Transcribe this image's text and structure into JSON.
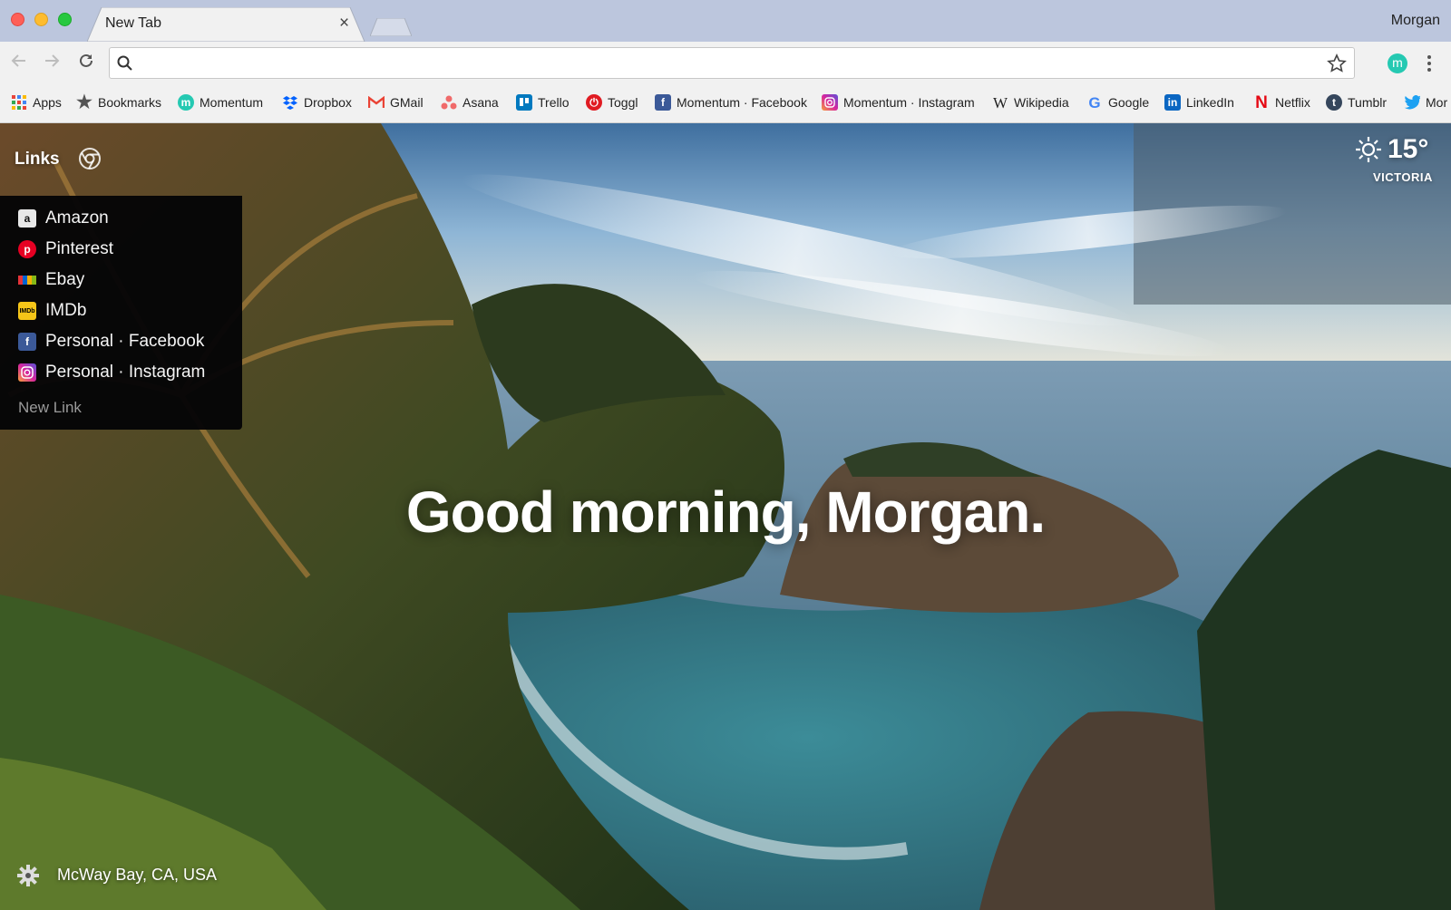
{
  "browser": {
    "tab_title": "New Tab",
    "tab_close": "×",
    "profile_name": "Morgan",
    "omnibox": {
      "value": "",
      "placeholder": ""
    },
    "extension_letter": "m",
    "bookmarks": [
      {
        "label": "Apps",
        "icon": "apps-grid-icon"
      },
      {
        "label": "Bookmarks",
        "icon": "star-icon"
      },
      {
        "label": "Momentum",
        "icon": "momentum-icon"
      },
      {
        "label": "Dropbox",
        "icon": "dropbox-icon"
      },
      {
        "label": "GMail",
        "icon": "gmail-icon"
      },
      {
        "label": "Asana",
        "icon": "asana-icon"
      },
      {
        "label": "Trello",
        "icon": "trello-icon"
      },
      {
        "label": "Toggl",
        "icon": "toggl-icon"
      },
      {
        "label": "Momentum · Facebook",
        "icon": "facebook-icon"
      },
      {
        "label": "Momentum · Instagram",
        "icon": "instagram-icon"
      },
      {
        "label": "Wikipedia",
        "icon": "wikipedia-icon"
      },
      {
        "label": "Google",
        "icon": "google-icon"
      },
      {
        "label": "LinkedIn",
        "icon": "linkedin-icon"
      },
      {
        "label": "Netflix",
        "icon": "netflix-icon"
      },
      {
        "label": "Tumblr",
        "icon": "tumblr-icon"
      },
      {
        "label": "Mor",
        "icon": "twitter-icon"
      }
    ]
  },
  "momentum": {
    "links_label": "Links",
    "links": [
      {
        "label": "Amazon",
        "icon": "amazon-icon"
      },
      {
        "label": "Pinterest",
        "icon": "pinterest-icon"
      },
      {
        "label": "Ebay",
        "icon": "ebay-icon"
      },
      {
        "label": "IMDb",
        "icon": "imdb-icon"
      },
      {
        "label": "Personal · Facebook",
        "icon": "facebook-icon"
      },
      {
        "label": "Personal · Instagram",
        "icon": "instagram-icon"
      }
    ],
    "new_link": "New Link",
    "weather": {
      "temp": "15°",
      "location": "VICTORIA",
      "icon": "sun-icon"
    },
    "greeting": "Good morning, Morgan.",
    "photo_location": "McWay Bay, CA, USA"
  },
  "colors": {
    "momentum_teal": "#25c9b2",
    "panel_bg": "#040406",
    "tabstrip": "#bcc6dd"
  }
}
